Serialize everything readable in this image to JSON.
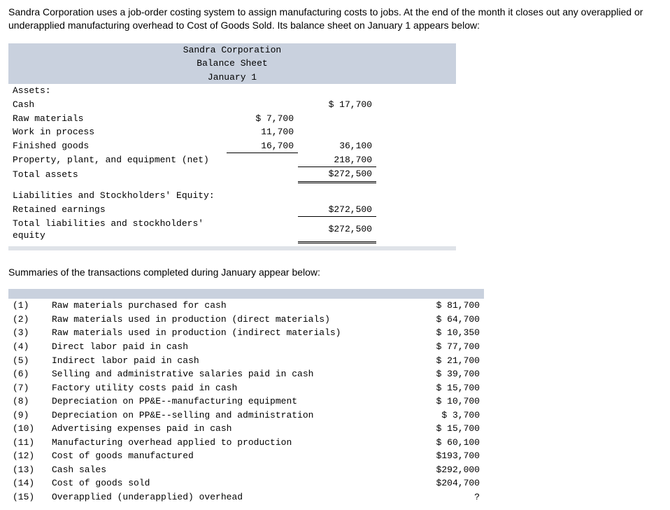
{
  "intro": "Sandra Corporation uses a job-order costing system to assign manufacturing costs to jobs. At the end of the month it closes out any overapplied or underapplied manufacturing overhead to Cost of Goods Sold. Its balance sheet on January 1 appears below:",
  "bs": {
    "company": "Sandra Corporation",
    "title": "Balance Sheet",
    "date": "January 1",
    "assets_heading": "Assets:",
    "cash_label": "Cash",
    "cash": "$ 17,700",
    "raw_label": "Raw materials",
    "raw": "$ 7,700",
    "wip_label": "Work in process",
    "wip": "11,700",
    "fg_label": "Finished goods",
    "fg": "16,700",
    "inv_total": "36,100",
    "ppe_label": "Property, plant, and equipment (net)",
    "ppe": "218,700",
    "total_assets_label": "Total assets",
    "total_assets": "$272,500",
    "liab_heading": "Liabilities and Stockholders' Equity:",
    "re_label": "Retained earnings",
    "re": "$272,500",
    "total_liab_label": "Total liabilities and stockholders' equity",
    "total_liab": "$272,500"
  },
  "summary_intro": "Summaries of the transactions completed during January appear below:",
  "tx": [
    {
      "n": "(1)",
      "label": "Raw materials purchased for cash",
      "amt": "$ 81,700"
    },
    {
      "n": "(2)",
      "label": "Raw materials used in production (direct materials)",
      "amt": "$ 64,700"
    },
    {
      "n": "(3)",
      "label": "Raw materials used in production (indirect materials)",
      "amt": "$ 10,350"
    },
    {
      "n": "(4)",
      "label": "Direct labor paid in cash",
      "amt": "$ 77,700"
    },
    {
      "n": "(5)",
      "label": "Indirect labor paid in cash",
      "amt": "$ 21,700"
    },
    {
      "n": "(6)",
      "label": "Selling and administrative salaries paid in cash",
      "amt": "$ 39,700"
    },
    {
      "n": "(7)",
      "label": "Factory utility costs paid in cash",
      "amt": "$ 15,700"
    },
    {
      "n": "(8)",
      "label": "Depreciation on PP&E--manufacturing equipment",
      "amt": "$ 10,700"
    },
    {
      "n": "(9)",
      "label": "Depreciation on PP&E--selling and administration",
      "amt": "$  3,700"
    },
    {
      "n": "(10)",
      "label": "Advertising expenses paid in cash",
      "amt": "$ 15,700"
    },
    {
      "n": "(11)",
      "label": "Manufacturing overhead applied to production",
      "amt": "$ 60,100"
    },
    {
      "n": "(12)",
      "label": "Cost of goods manufactured",
      "amt": "$193,700"
    },
    {
      "n": "(13)",
      "label": "Cash sales",
      "amt": "$292,000"
    },
    {
      "n": "(14)",
      "label": "Cost of goods sold",
      "amt": "$204,700"
    },
    {
      "n": "(15)",
      "label": "Overapplied (underapplied) overhead",
      "amt": "?"
    }
  ]
}
